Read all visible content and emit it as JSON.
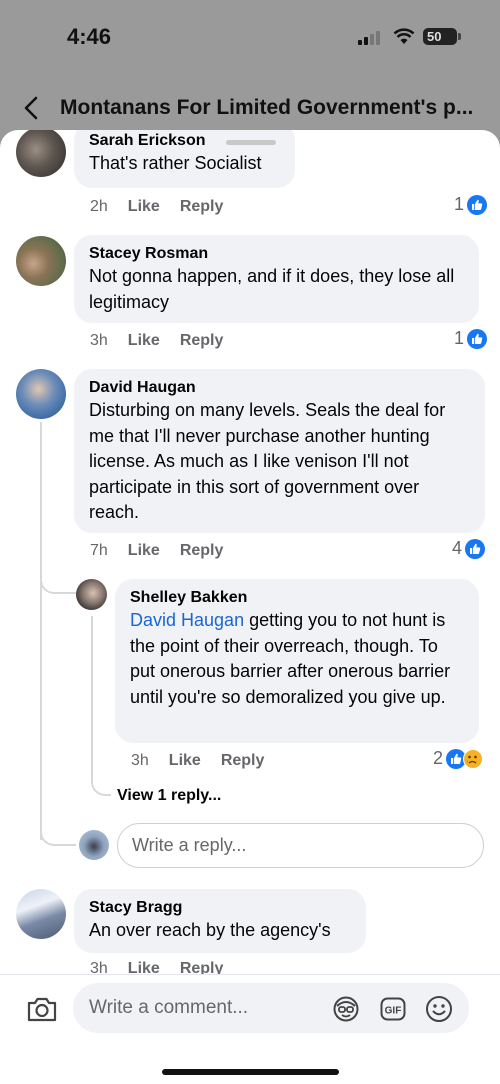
{
  "status": {
    "time": "4:46",
    "battery": "50"
  },
  "header": {
    "title": "Montanans For Limited Government's p..."
  },
  "comments": [
    {
      "name": "Sarah Erickson",
      "text": "That's rather Socialist",
      "age": "2h",
      "like": "Like",
      "reply": "Reply",
      "reactions": "1"
    },
    {
      "name": "Stacey Rosman",
      "text": "Not gonna happen, and if it does, they lose all legitimacy",
      "age": "3h",
      "like": "Like",
      "reply": "Reply",
      "reactions": "1"
    },
    {
      "name": "David Haugan",
      "text": "Disturbing on many levels. Seals the deal for me that I'll never purchase another hunting license. As much as I like venison I'll not participate in this sort of government over reach.",
      "age": "7h",
      "like": "Like",
      "reply": "Reply",
      "reactions": "4"
    },
    {
      "name": "Stacy Bragg",
      "text": "An over reach by the agency's",
      "age": "3h",
      "like": "Like",
      "reply": "Reply"
    }
  ],
  "reply": {
    "name": "Shelley Bakken",
    "mention": "David Haugan",
    "text": " getting you to not hunt is the point of their overreach, though. To put onerous barrier after onerous barrier until you're so demoralized you give up.",
    "age": "3h",
    "like": "Like",
    "reply": "Reply",
    "reactions": "2"
  },
  "view_replies": "View 1 reply...",
  "reply_placeholder": "Write a reply...",
  "comment_placeholder": "Write a comment...",
  "icons": [
    "back-icon",
    "camera-icon",
    "avatar-sticker-icon",
    "gif-icon",
    "emoji-icon",
    "like-icon",
    "sad-icon"
  ],
  "colors": {
    "like_blue": "#1877f2",
    "mention_blue": "#1b66d2",
    "bubble": "#f0f2f5"
  }
}
